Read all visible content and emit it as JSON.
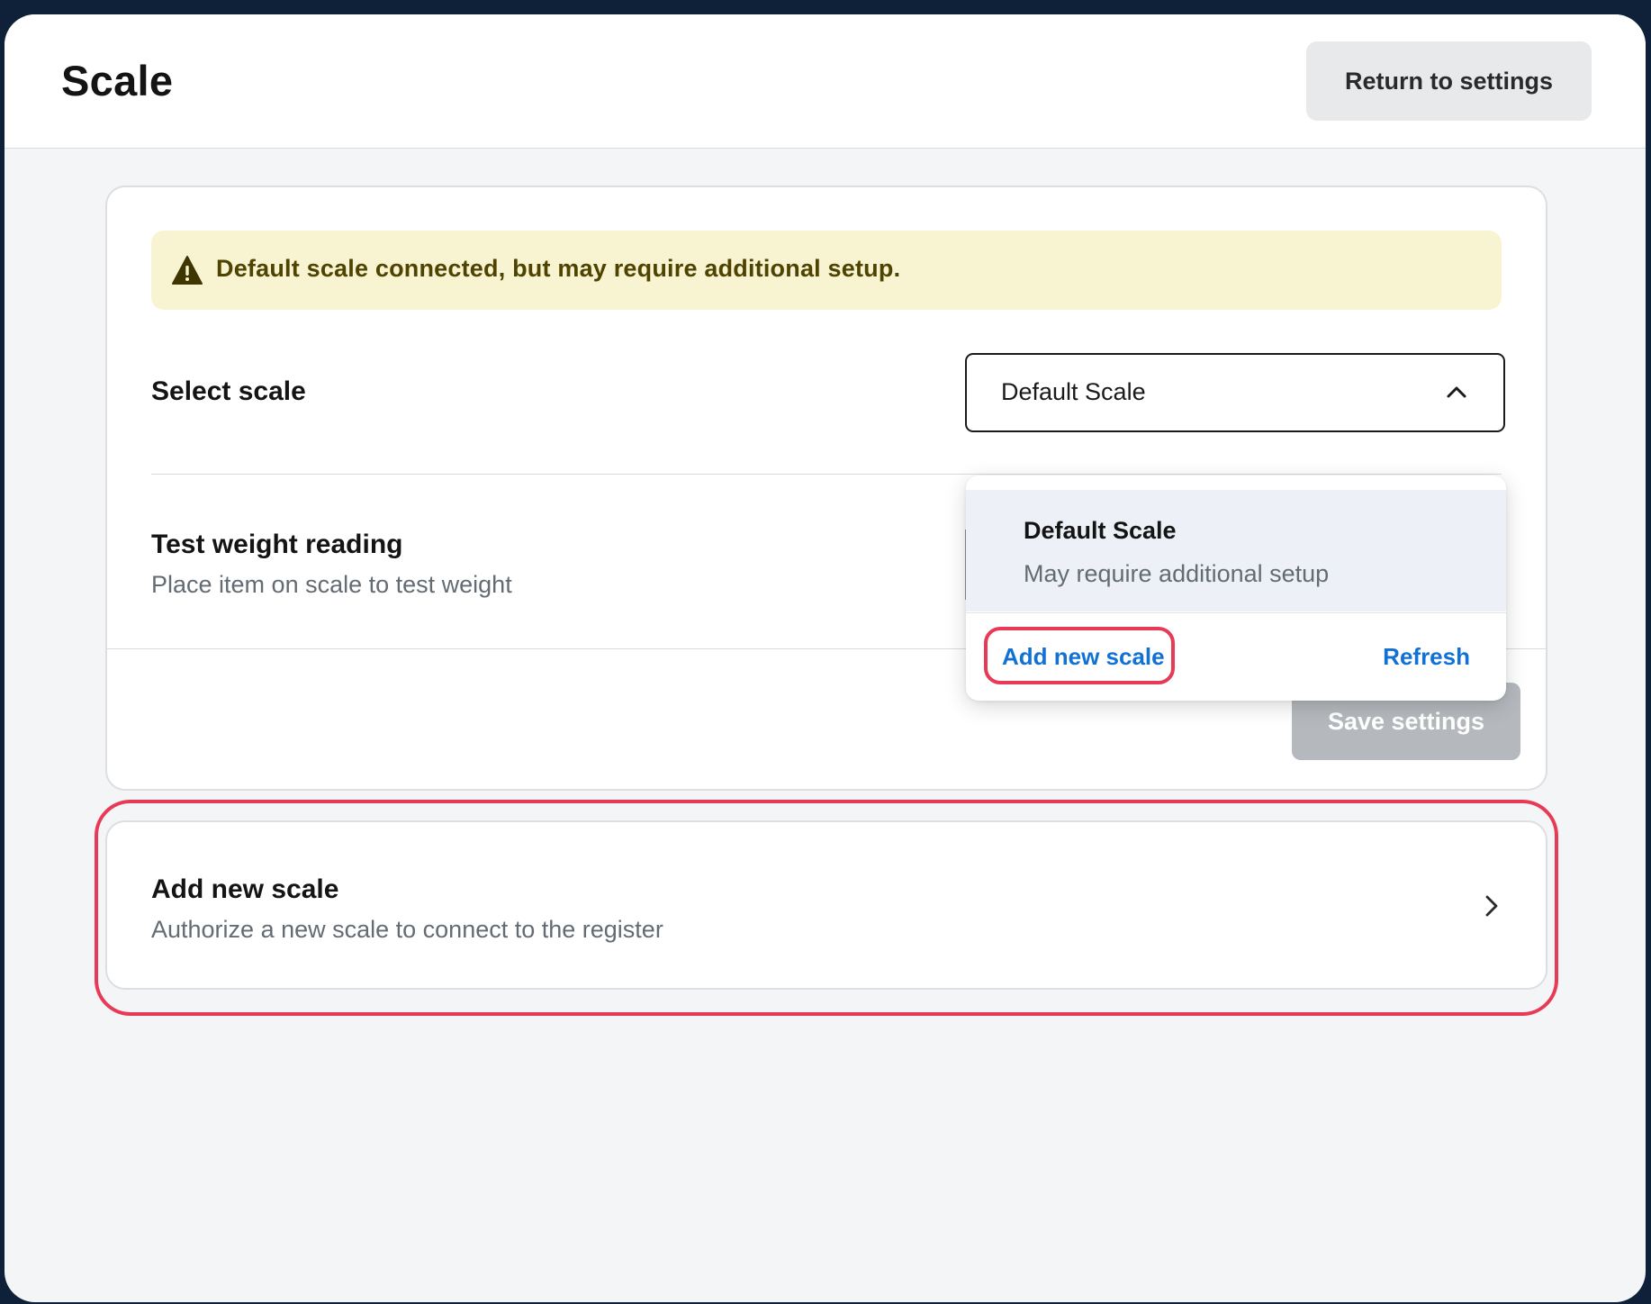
{
  "header": {
    "title": "Scale",
    "return_label": "Return to settings"
  },
  "alert": {
    "icon": "warning-icon",
    "message": "Default scale connected, but may require additional setup."
  },
  "select_scale": {
    "label": "Select scale",
    "value": "Default Scale",
    "icon": "chevron-up-icon"
  },
  "test_weight": {
    "title": "Test weight reading",
    "subtitle": "Place item on scale to test weight"
  },
  "save_label": "Save settings",
  "dropdown": {
    "options": [
      {
        "title": "Default Scale",
        "subtitle": "May require additional setup"
      }
    ],
    "add_label": "Add new scale",
    "refresh_label": "Refresh"
  },
  "add_scale_card": {
    "title": "Add new scale",
    "subtitle": "Authorize a new scale to connect to the register",
    "icon": "chevron-right-icon"
  },
  "colors": {
    "highlight": "#e83a57",
    "link": "#1171d4",
    "alert_bg": "#f8f4d2",
    "alert_text": "#4e4300"
  }
}
